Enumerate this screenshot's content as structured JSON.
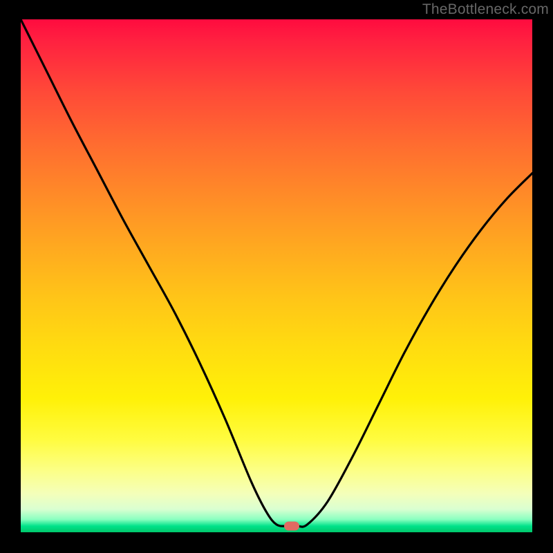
{
  "watermark": "TheBottleneck.com",
  "chart_data": {
    "type": "line",
    "title": "",
    "xlabel": "",
    "ylabel": "",
    "x_range": [
      0,
      100
    ],
    "y_range": [
      0,
      100
    ],
    "grid": false,
    "legend": false,
    "background_gradient": {
      "direction": "vertical",
      "stops": [
        {
          "pos": 0.0,
          "color": "#ff0b3f"
        },
        {
          "pos": 0.5,
          "color": "#ffb81c"
        },
        {
          "pos": 0.8,
          "color": "#fffa30"
        },
        {
          "pos": 0.96,
          "color": "#ccffc8"
        },
        {
          "pos": 1.0,
          "color": "#00c86a"
        }
      ]
    },
    "series": [
      {
        "name": "bottleneck-curve",
        "x": [
          0,
          5,
          10,
          15,
          20,
          25,
          30,
          35,
          40,
          45,
          48,
          50,
          52,
          54,
          56,
          60,
          65,
          70,
          75,
          80,
          85,
          90,
          95,
          100
        ],
        "y": [
          100,
          90,
          80,
          70.5,
          61,
          52,
          43,
          33,
          22,
          10,
          4,
          1.5,
          1.2,
          1.2,
          1.5,
          6,
          15,
          25,
          35,
          44,
          52,
          59,
          65,
          70
        ]
      }
    ],
    "marker": {
      "x": 53,
      "y": 1.2,
      "color": "#e06a62",
      "semantic": "optimal-point"
    }
  }
}
